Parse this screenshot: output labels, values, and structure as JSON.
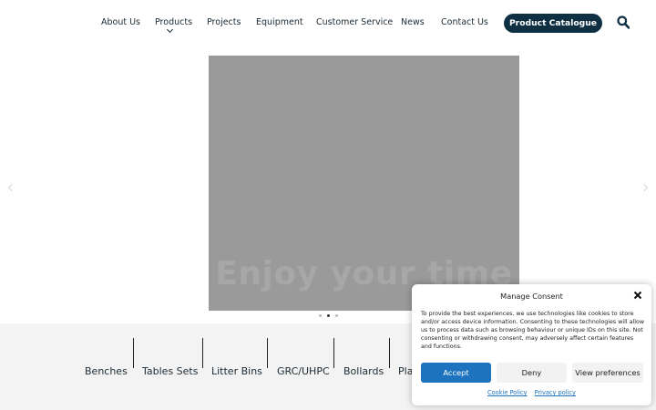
{
  "nav": {
    "items": [
      "About Us",
      "Products",
      "Projects",
      "Equipment",
      "Customer Service",
      "News",
      "Contact Us"
    ],
    "catalogue_button": "Product Catalogue",
    "search_icon": "search-icon"
  },
  "slider": {
    "caption": "Enjoy your time",
    "dot_count": 3,
    "active_dot": 2
  },
  "categories": [
    "Benches",
    "Tables Sets",
    "Litter Bins",
    "GRC/UHPC",
    "Bollards",
    "Pla"
  ],
  "consent": {
    "title": "Manage Consent",
    "text": "To provide the best experiences, we use technologies like cookies to store and/or access device information. Consenting to these technologies will allow us to process data such as browsing behaviour or unique IDs on this site. Not consenting or withdrawing consent, may adversely affect certain features and functions.",
    "accept_label": "Accept",
    "deny_label": "Deny",
    "preferences_label": "View preferences",
    "cookie_policy_label": "Cookie Policy",
    "privacy_policy_label": "Privacy policy"
  },
  "colors": {
    "brand_dark": "#0f3042",
    "accept_blue": "#1e73be",
    "slide_gray": "#9a9a9a"
  }
}
